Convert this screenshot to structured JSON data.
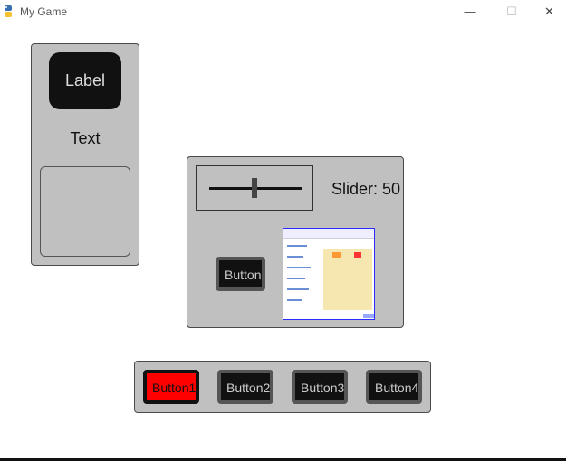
{
  "window": {
    "title": "My Game",
    "minimize": "—",
    "maximize": "☐",
    "close": "✕"
  },
  "panel1": {
    "label": "Label",
    "text": "Text"
  },
  "panel2": {
    "slider_text": "Slider: 50",
    "slider_value": 50,
    "button": "Button"
  },
  "panel3": {
    "buttons": [
      "Button1",
      "Button2",
      "Button3",
      "Button4"
    ]
  },
  "colors": {
    "background": "#ffffff",
    "panel": "#c0c0c0",
    "dark": "#111111",
    "selected": "#ff0000"
  }
}
